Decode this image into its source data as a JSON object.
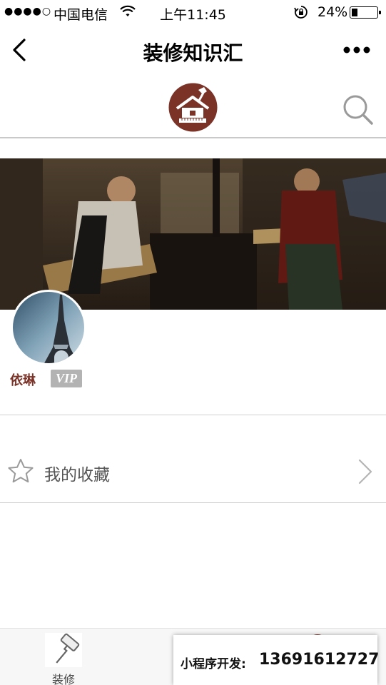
{
  "status_bar": {
    "signal": "●●●●○",
    "carrier": "中国电信",
    "time": "上午11:45",
    "battery_percent_text": "24%",
    "battery_level": 0.24,
    "icons": [
      "wifi-icon",
      "rotation-lock-icon",
      "battery-icon"
    ]
  },
  "nav": {
    "title": "装修知识汇",
    "icons": [
      "back-icon",
      "more-icon"
    ]
  },
  "header": {
    "icons": [
      "house-logo-icon",
      "search-icon"
    ],
    "logo_color": "#7b3328"
  },
  "profile": {
    "name": "依琳",
    "badge": "VIP",
    "name_color": "#7b3328"
  },
  "menu": {
    "favorites_label": "我的收藏",
    "icons": [
      "star-icon",
      "chevron-right-icon"
    ]
  },
  "tab_bar": {
    "tabs": [
      {
        "label": "装修",
        "icon": "paint-roller-icon"
      }
    ]
  },
  "promo": {
    "label": "小程序开发:",
    "phone": "13691612727"
  }
}
